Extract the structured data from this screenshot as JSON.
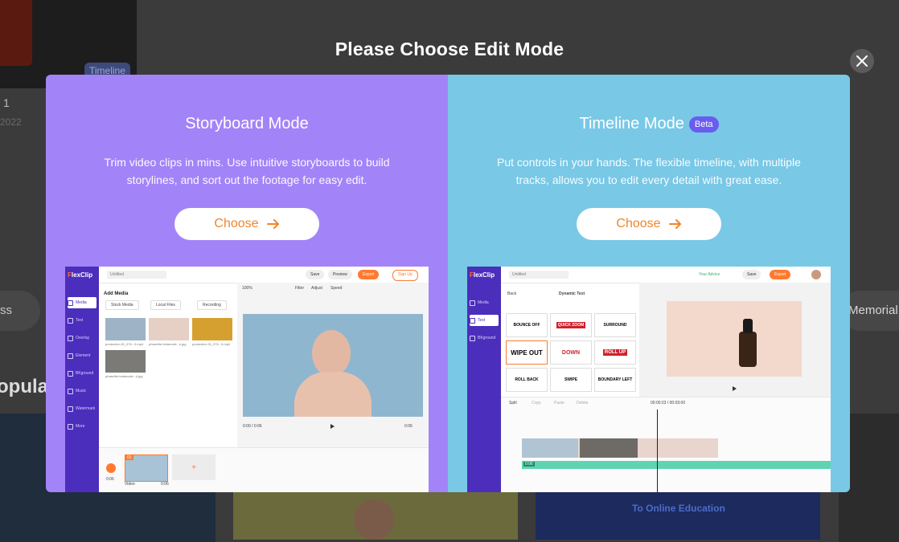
{
  "background": {
    "badge": "Timeline",
    "card_number": "1",
    "card_year": "2022",
    "pill_left": "ss",
    "pill_right": "Memorial",
    "section_heading": "opular",
    "thumb_caption": "To Online Education"
  },
  "modal": {
    "title": "Please Choose Edit Mode",
    "close_icon": "close-icon"
  },
  "storyboard": {
    "title": "Storyboard Mode",
    "description": "Trim video clips in mins. Use intuitive storyboards to build storylines, and sort out the footage for easy edit.",
    "choose_label": "Choose",
    "choose_icon": "arrow-right-icon",
    "bg_color": "#a383f8",
    "preview": {
      "logo_prefix": "F",
      "logo_rest": "lexClip",
      "project_name": "Untitled",
      "top_buttons": [
        "Save",
        "Preview",
        "Export",
        "Sign Up"
      ],
      "nav": [
        "Media",
        "Text",
        "Overlay",
        "Element",
        "BKground",
        "Music",
        "Watermark",
        "More"
      ],
      "add_media": "Add Media",
      "media_buttons": [
        "Stock Media",
        "Local Files",
        "Recording"
      ],
      "media_items": [
        "production ID_376...0.mp4",
        "phaselite-betancale...k.jpg",
        "production ID_376...0.mp4",
        "phaselite-betancale...k.jpg"
      ],
      "toolbar": [
        "100%",
        "Filter",
        "Adjust",
        "Speed"
      ],
      "time_left": "0:00 / 0:06",
      "time_right": "0:06",
      "scene_label": "Video",
      "scene_time": "0:06",
      "scene_index": "01"
    }
  },
  "timeline": {
    "title": "Timeline Mode",
    "badge": "Beta",
    "description": "Put controls in your hands. The flexible timeline, with multiple tracks, allows you to edit every detail with great ease.",
    "choose_label": "Choose",
    "choose_icon": "arrow-right-icon",
    "bg_color": "#78c8e6",
    "preview": {
      "logo_prefix": "F",
      "logo_rest": "lexClip",
      "project_name": "Untitled",
      "advice": "Your Advice",
      "top_buttons": [
        "Save",
        "Export"
      ],
      "nav": [
        "Media",
        "Text",
        "BKground"
      ],
      "back": "Back",
      "panel_title": "Dynamic Text",
      "text_tiles": [
        "BOUNCE OFF",
        "QUICK ZOOM",
        "SURROUND",
        "WIPE OUT",
        "DOWN",
        "ROLL UP",
        "ROLL BACK",
        "SWIPE",
        "BOUNDARY LEFT"
      ],
      "timeline_tools": [
        "Split",
        "Copy",
        "Paste",
        "Delete"
      ],
      "timecode": "00:00:23 / 00:03:00",
      "audio_label": "0:06"
    }
  }
}
